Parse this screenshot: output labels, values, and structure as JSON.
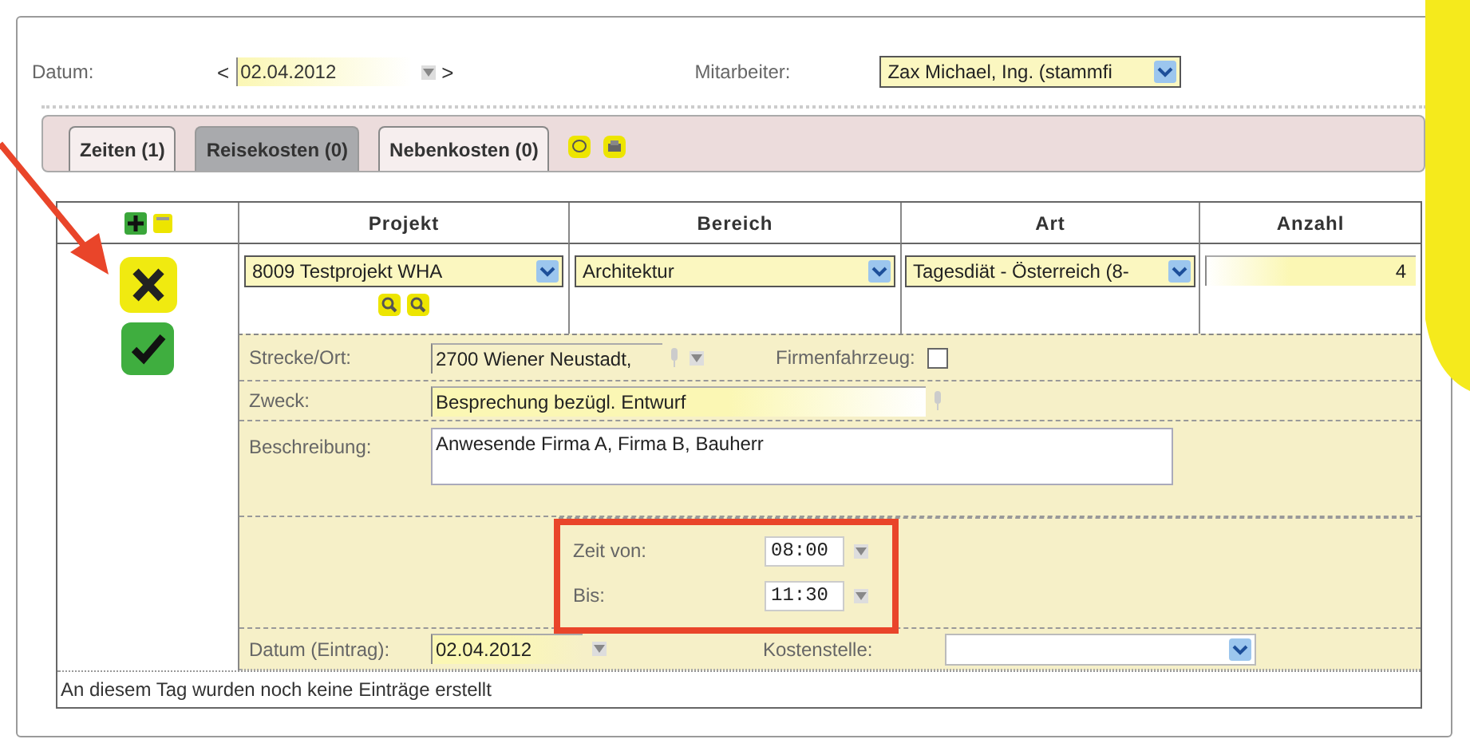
{
  "date_nav": {
    "label": "Datum:",
    "prev": "<",
    "value": "02.04.2012",
    "next": ">"
  },
  "employee": {
    "label": "Mitarbeiter:",
    "value": "Zax Michael, Ing. (stammfi"
  },
  "tabs": [
    {
      "label": "Zeiten (1)",
      "selected": false
    },
    {
      "label": "Reisekosten (0)",
      "selected": true
    },
    {
      "label": "Nebenkosten (0)",
      "selected": false
    }
  ],
  "table": {
    "columns": [
      "Projekt",
      "Bereich",
      "Art",
      "Anzahl"
    ],
    "entry": {
      "projekt": "8009 Testprojekt WHA",
      "bereich": "Architektur",
      "art": "Tagesdiät - Österreich (8-",
      "anzahl": "4"
    }
  },
  "details": {
    "strecke": {
      "label": "Strecke/Ort:",
      "value": "2700 Wiener Neustadt,"
    },
    "firmenfahrzeug": {
      "label": "Firmenfahrzeug:",
      "checked": false
    },
    "zweck": {
      "label": "Zweck:",
      "value": "Besprechung bezügl. Entwurf"
    },
    "beschreibung": {
      "label": "Beschreibung:",
      "value": "Anwesende Firma A, Firma B, Bauherr"
    },
    "zeit_von": {
      "label": "Zeit von:",
      "value": "08:00"
    },
    "bis": {
      "label": "Bis:",
      "value": "11:30"
    },
    "datum_eintrag": {
      "label": "Datum (Eintrag):",
      "value": "02.04.2012"
    },
    "kostenstelle": {
      "label": "Kostenstelle:"
    }
  },
  "status_text": "An diesem Tag wurden noch keine Einträge erstellt"
}
